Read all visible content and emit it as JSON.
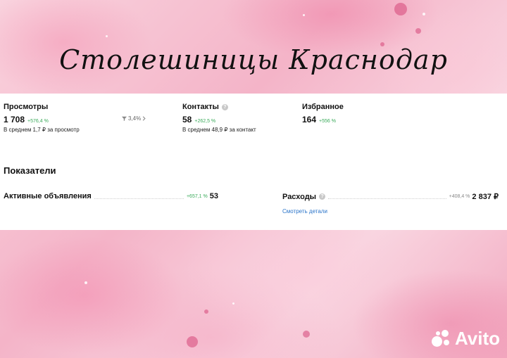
{
  "header": {
    "shop_title": "Столешиницы Краснодар"
  },
  "stats": {
    "views": {
      "label": "Просмотры",
      "value": "1 708",
      "delta": "+576,4 %",
      "sub": "В среднем 1,7 ₽ за просмотр",
      "filter": "3,4%"
    },
    "contacts": {
      "label": "Контакты",
      "value": "58",
      "delta": "+262,5 %",
      "sub": "В среднем 48,9 ₽ за контакт"
    },
    "favorites": {
      "label": "Избранное",
      "value": "164",
      "delta": "+556 %"
    }
  },
  "indicators": {
    "title": "Показатели",
    "active_ads": {
      "label": "Активные объявления",
      "delta": "+657,1 %",
      "value": "53"
    },
    "expenses": {
      "label": "Расходы",
      "delta": "+408,4 %",
      "value": "2 837 ₽",
      "link": "Смотреть детали"
    }
  },
  "watermark": {
    "brand": "Avito"
  },
  "colors": {
    "accent_green": "#3aaa5a",
    "link_blue": "#2a74c9",
    "background_pink": "#f7c6d4"
  },
  "icons": [
    "info-icon",
    "filter-icon",
    "chevron-right-icon",
    "avito-logo-icon"
  ]
}
